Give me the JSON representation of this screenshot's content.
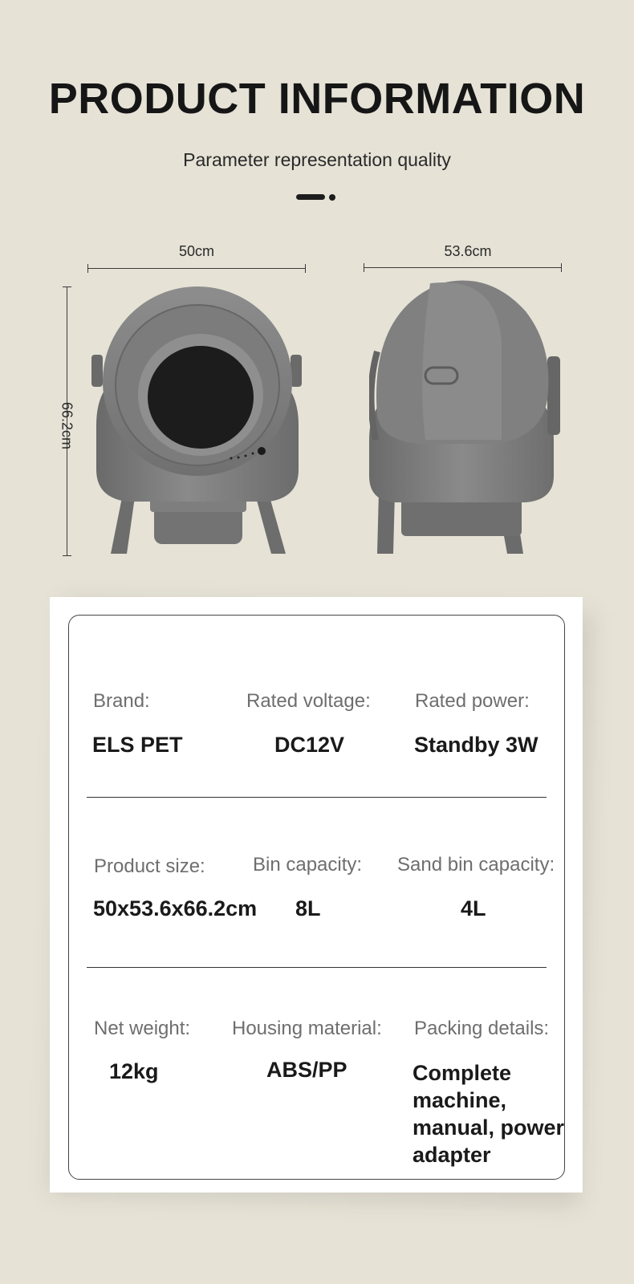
{
  "header": {
    "title": "PRODUCT INFORMATION",
    "subtitle": "Parameter representation quality"
  },
  "dimensions": {
    "front_width": "50cm",
    "side_depth": "53.6cm",
    "height": "66.2cm"
  },
  "colors": {
    "background": "#e6e2d6",
    "product_gray": "#7a7a7a",
    "card": "#ffffff"
  },
  "specs": {
    "row1": [
      {
        "label": "Brand:",
        "value": "ELS PET"
      },
      {
        "label": "Rated voltage:",
        "value": "DC12V"
      },
      {
        "label": "Rated power:",
        "value": "Standby 3W"
      }
    ],
    "row2": [
      {
        "label": "Product size:",
        "value": "50x53.6x66.2cm"
      },
      {
        "label": "Bin capacity:",
        "value": "8L"
      },
      {
        "label": "Sand bin capacity:",
        "value": "4L"
      }
    ],
    "row3": [
      {
        "label": "Net weight:",
        "value": "12kg"
      },
      {
        "label": "Housing material:",
        "value": "ABS/PP"
      },
      {
        "label": "Packing details:",
        "value": "Complete machine, manual, power adapter"
      }
    ]
  }
}
